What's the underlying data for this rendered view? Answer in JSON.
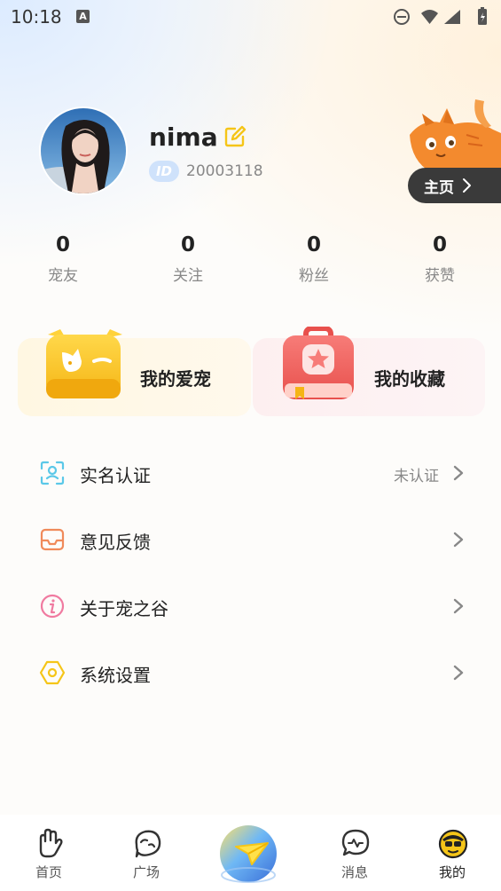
{
  "status_bar": {
    "time": "10:18",
    "notif_letter": "A"
  },
  "profile": {
    "username": "nima",
    "id_badge": "ID",
    "user_id": "20003118",
    "home_button": "主页"
  },
  "stats": [
    {
      "value": "0",
      "label": "宠友"
    },
    {
      "value": "0",
      "label": "关注"
    },
    {
      "value": "0",
      "label": "粉丝"
    },
    {
      "value": "0",
      "label": "获赞"
    }
  ],
  "cards": {
    "pets": "我的爱宠",
    "favorites": "我的收藏"
  },
  "menu": [
    {
      "label": "实名认证",
      "status": "未认证",
      "icon": "id-scan-icon"
    },
    {
      "label": "意见反馈",
      "icon": "feedback-envelope-icon"
    },
    {
      "label": "关于宠之谷",
      "icon": "info-icon"
    },
    {
      "label": "系统设置",
      "icon": "settings-hexagon-icon"
    }
  ],
  "tabs": [
    {
      "label": "首页",
      "icon": "hand-paw-icon"
    },
    {
      "label": "广场",
      "icon": "plaza-icon"
    },
    {
      "label": "消息",
      "icon": "message-icon"
    },
    {
      "label": "我的",
      "icon": "my-face-icon",
      "active": true
    }
  ],
  "colors": {
    "accent_yellow": "#f5c518",
    "home_button_bg": "#3a3a3a"
  }
}
